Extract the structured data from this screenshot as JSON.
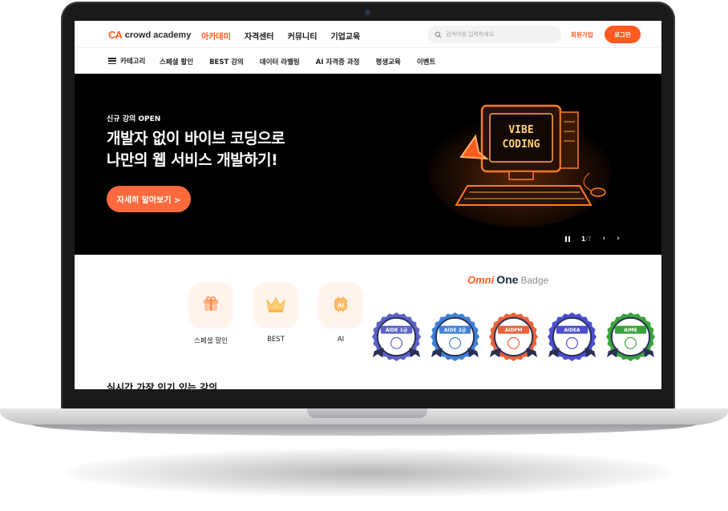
{
  "header": {
    "logo_mark": "CA",
    "logo_text": "crowd academy",
    "nav": [
      {
        "label": "아카데미",
        "active": true
      },
      {
        "label": "자격센터",
        "active": false
      },
      {
        "label": "커뮤니티",
        "active": false
      },
      {
        "label": "기업교육",
        "active": false
      }
    ],
    "search_placeholder": "검색어를 입력하세요",
    "signup_label": "회원가입",
    "login_label": "로그인"
  },
  "subnav": {
    "category_label": "카테고리",
    "items": [
      "스페셜 할인",
      "BEST 강의",
      "데이터 라벨링",
      "AI 자격증 과정",
      "평생교육",
      "이벤트"
    ]
  },
  "hero": {
    "kicker": "신규 강의 OPEN",
    "title_line1": "개발자 없이 바이브 코딩으로",
    "title_line2": "나만의 웹 서비스 개발하기!",
    "button_label": "자세히 알아보기 >",
    "art_text_line1": "VIBE",
    "art_text_line2": "CODING",
    "pager_current": "1",
    "pager_total": "/7"
  },
  "quick_menu": [
    {
      "label": "스페셜 할인",
      "icon": "gift-box-icon"
    },
    {
      "label": "BEST",
      "icon": "crown-icon"
    },
    {
      "label": "AI",
      "icon": "ai-chip-icon"
    }
  ],
  "onebadge": {
    "logo_mark": "Omni",
    "logo_one": "One",
    "logo_badge": "Badge",
    "badges": [
      {
        "label": "AIDE 1급",
        "color": "#5b63c9"
      },
      {
        "label": "AIDE 2급",
        "color": "#3f7fd8"
      },
      {
        "label": "AIDPM",
        "color": "#e8623a"
      },
      {
        "label": "AIDEA",
        "color": "#4a4fd0"
      },
      {
        "label": "AIME",
        "color": "#3aa23d"
      }
    ]
  },
  "section_title": "실시간 가장 인기 있는 강의",
  "colors": {
    "accent": "#ff5a1f",
    "hero_bg": "#000000"
  }
}
